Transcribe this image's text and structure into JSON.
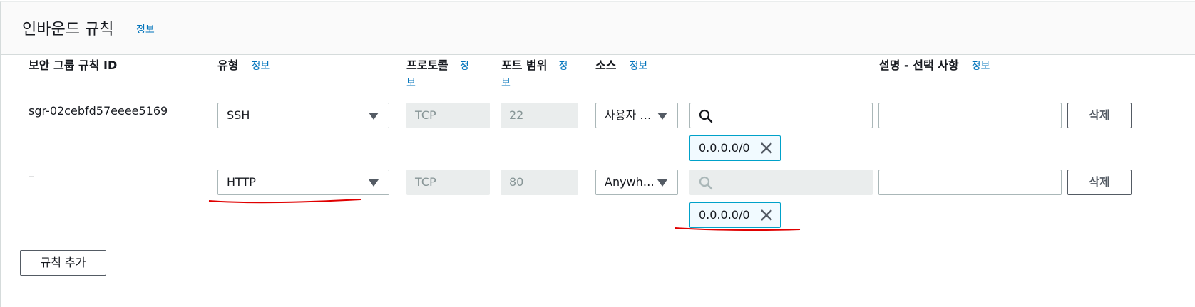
{
  "panel": {
    "title": "인바운드 규칙",
    "info": "정보"
  },
  "columns": {
    "rule_id": "보안 그룹 규칙 ID",
    "type": "유형",
    "protocol_l1": "프로토콜",
    "protocol_info_l1": "정",
    "protocol_info_l2": "보",
    "port_l1": "포트 범위",
    "port_info_l1": "정",
    "port_info_l2": "보",
    "source": "소스",
    "description": "설명 - 선택 사항",
    "info": "정보"
  },
  "rules": [
    {
      "id": "sgr-02cebfd57eeee5169",
      "type": "SSH",
      "protocol": "TCP",
      "port": "22",
      "source_type": "사용자 …",
      "search_value": "",
      "cidr": "0.0.0.0/0",
      "description": "",
      "delete_label": "삭제"
    },
    {
      "id": "–",
      "type": "HTTP",
      "protocol": "TCP",
      "port": "80",
      "source_type": "Anywh…",
      "search_value": "",
      "cidr": "0.0.0.0/0",
      "description": "",
      "delete_label": "삭제"
    }
  ],
  "add_rule_label": "규칙 추가",
  "colors": {
    "link": "#0073bb",
    "annotation": "#e00000",
    "token_border": "#00a1c9"
  }
}
